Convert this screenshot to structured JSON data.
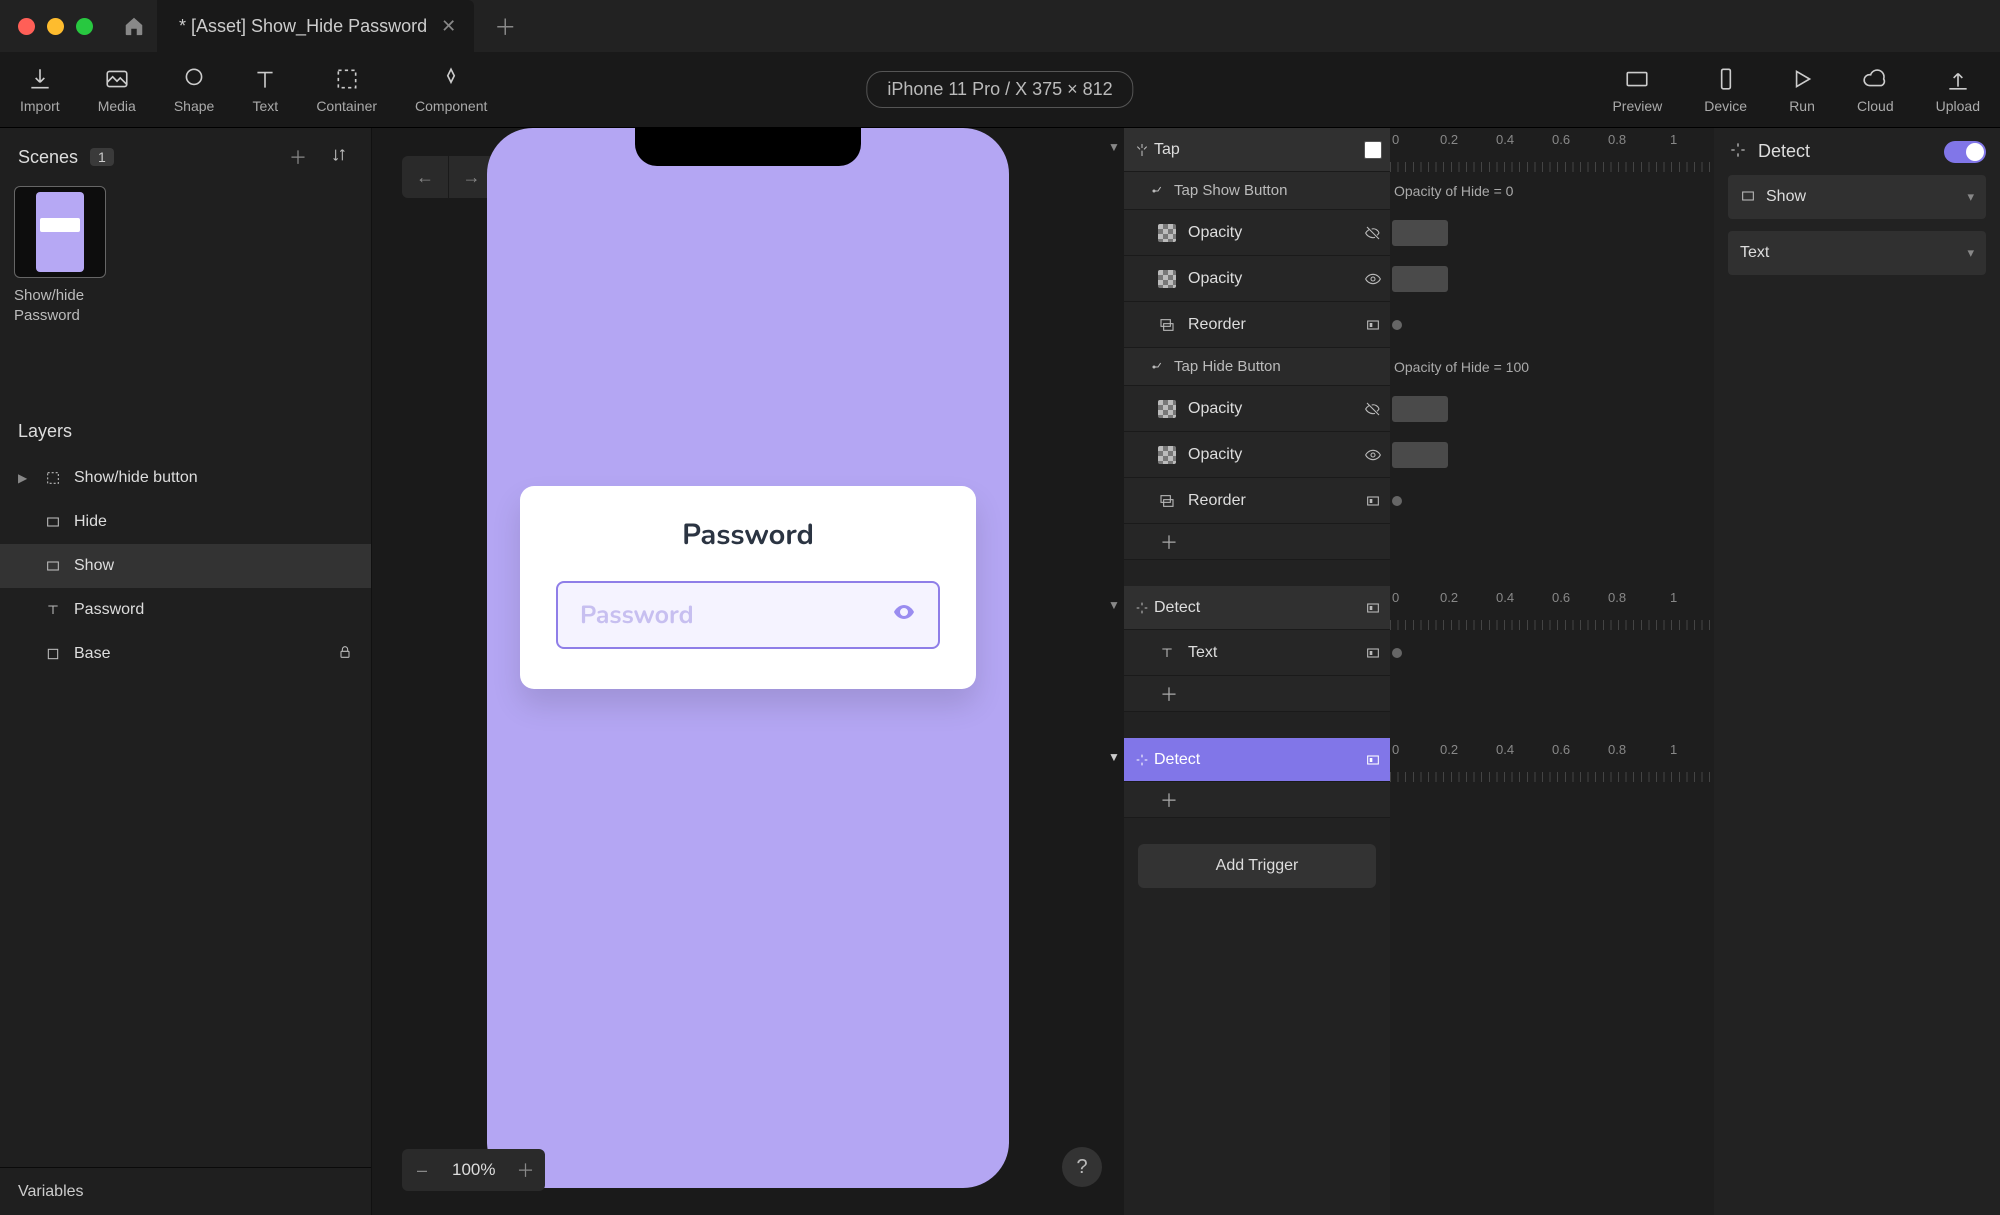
{
  "tab": {
    "title": "* [Asset] Show_Hide Password"
  },
  "toolbar": {
    "import": "Import",
    "media": "Media",
    "shape": "Shape",
    "text": "Text",
    "container": "Container",
    "component": "Component",
    "device": "iPhone 11 Pro / X  375 × 812",
    "preview": "Preview",
    "device_btn": "Device",
    "run": "Run",
    "cloud": "Cloud",
    "upload": "Upload"
  },
  "scenes": {
    "heading": "Scenes",
    "count": "1",
    "item": "Show/hide Password"
  },
  "layers": {
    "heading": "Layers",
    "items": [
      {
        "name": "Show/hide button",
        "icon": "frame",
        "chev": true,
        "indent": 0
      },
      {
        "name": "Hide",
        "icon": "rect",
        "indent": 1
      },
      {
        "name": "Show",
        "icon": "rect",
        "indent": 1,
        "selected": true
      },
      {
        "name": "Password",
        "icon": "text",
        "indent": 1
      },
      {
        "name": "Base",
        "icon": "fill",
        "indent": 1,
        "locked": true
      }
    ]
  },
  "variables": {
    "heading": "Variables"
  },
  "canvas": {
    "card_title": "Password",
    "placeholder": "Password",
    "zoom": "100%"
  },
  "ruler": {
    "ticks": [
      "0",
      "0.2",
      "0.4",
      "0.6",
      "0.8",
      "1"
    ],
    "info1": "Opacity of Hide = 0",
    "info2": "Opacity of Hide = 100"
  },
  "timeline": {
    "tap": "Tap",
    "tap_show": "Tap Show Button",
    "tap_hide": "Tap Hide Button",
    "opacity": "Opacity",
    "reorder": "Reorder",
    "detect": "Detect",
    "text": "Text",
    "add_trigger": "Add Trigger"
  },
  "inspector": {
    "heading": "Detect",
    "select1": "Show",
    "select2": "Text"
  }
}
